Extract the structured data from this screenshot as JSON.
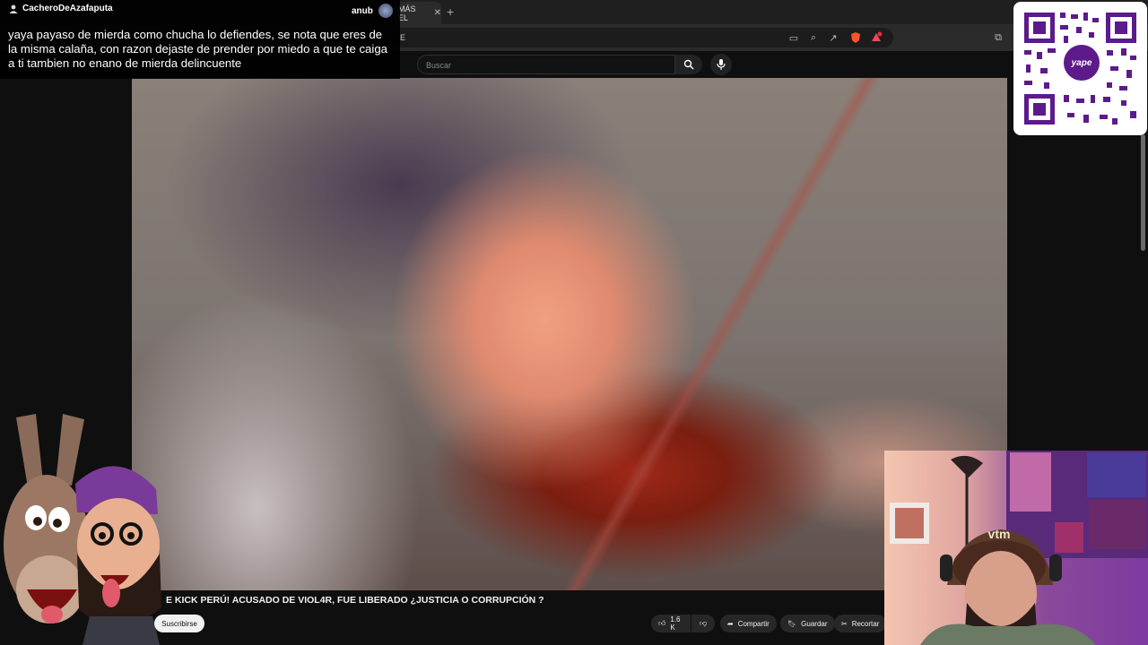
{
  "browser": {
    "tab_title": "MÁS EL",
    "url_fragment": "E"
  },
  "youtube": {
    "search_placeholder": "Buscar"
  },
  "chat": {
    "username": "CacheroDeAzafaputa",
    "channel": "anub",
    "message": "yaya payaso de mierda como chucha lo defiendes, se nota que eres de la misma calaña, con razon dejaste de prender por miedo a que te caiga a ti tambien no enano de mierda delincuente"
  },
  "qr": {
    "logo_text": "yape",
    "logo_color": "#5c1a8a"
  },
  "video": {
    "title": "E KICK PERÚ! ACUSADO DE VIOL4R, FUE LIBERADO ¿JUSTICIA O CORRUPCIÓN ?",
    "subscribe_label": "Suscribirse",
    "likes": "1.6 K",
    "share_label": "Compartir",
    "save_label": "Guardar",
    "clip_label": "Recortar"
  },
  "webcam": {
    "cap_text": "vtm"
  },
  "colors": {
    "page_bg": "#0f0f0f",
    "chrome_bg": "#2b2b2b",
    "chip_bg": "#272727"
  }
}
